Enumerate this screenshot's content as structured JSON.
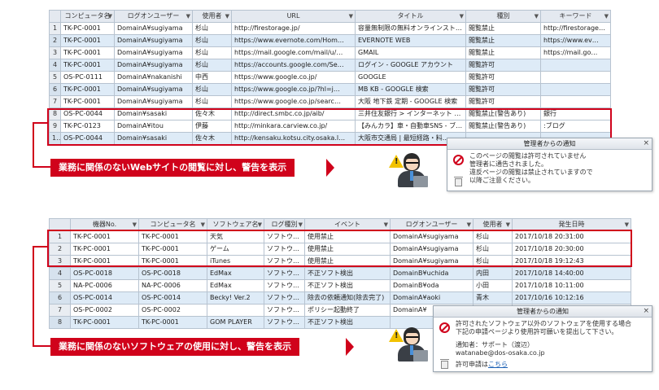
{
  "table1": {
    "headers": [
      "",
      "コンピュータ名",
      "ログオンユーザー",
      "使用者",
      "URL",
      "タイトル",
      "種別",
      "キーワード"
    ],
    "filter_glyph": "▼",
    "rows": [
      [
        "1",
        "TK-PC-0001",
        "DomainA¥sugiyama",
        "杉山",
        "http://firestorage.jp/",
        "容量無制限の無料オンラインストレ…",
        "閲覧禁止",
        "http://firestorage…"
      ],
      [
        "2",
        "TK-PC-0001",
        "DomainA¥sugiyama",
        "杉山",
        "https://www.evernote.com/Hom…",
        "EVERNOTE WEB",
        "閲覧禁止",
        "https://www.ev…"
      ],
      [
        "3",
        "TK-PC-0001",
        "DomainA¥sugiyama",
        "杉山",
        "https://mail.google.com/mail/u/…",
        "GMAIL",
        "閲覧禁止",
        "https://mail.go…"
      ],
      [
        "4",
        "TK-PC-0001",
        "DomainA¥sugiyama",
        "杉山",
        "https://accounts.google.com/Se…",
        "ログイン - GOOGLE アカウント",
        "閲覧許可",
        ""
      ],
      [
        "5",
        "OS-PC-0111",
        "DomainA¥nakanishi",
        "中西",
        "https://www.google.co.jp/",
        "GOOGLE",
        "閲覧許可",
        ""
      ],
      [
        "6",
        "TK-PC-0001",
        "DomainA¥sugiyama",
        "杉山",
        "https://www.google.co.jp/?hl=j…",
        "MB KB - GOOGLE 検索",
        "閲覧許可",
        ""
      ],
      [
        "7",
        "TK-PC-0001",
        "DomainA¥sugiyama",
        "杉山",
        "https://www.google.co.jp/searc…",
        "大阪 地下鉄 定期 - GOOGLE 検索",
        "閲覧許可",
        ""
      ],
      [
        "8",
        "OS-PC-0044",
        "Domain¥sasaki",
        "佐々木",
        "http://direct.smbc.co.jp/aib/",
        "三井住友銀行 > インターネット バ…",
        "閲覧禁止(警告あり)",
        "銀行"
      ],
      [
        "9",
        "TK-PC-0123",
        "DomainA¥itou",
        "伊藤",
        "http://minkara.carview.co.jp/",
        "【みんカラ】車・自動車SNS - ブロ…",
        "閲覧禁止(警告あり)",
        ":ブログ"
      ],
      [
        "10",
        "OS-PC-0044",
        "Domain¥sasaki",
        "佐々木",
        "http://kensaku.kotsu.city.osaka.l…",
        "大阪市交通局 | 最短経路・料…",
        "",
        ""
      ]
    ]
  },
  "banner1": "業務に関係のないWebサイトの閲覧に対し、警告を表示",
  "popup1": {
    "title": "管理者からの通知",
    "close": "×",
    "lines": [
      "このページの閲覧は許可されていません",
      "管理者に通告されました。",
      "違反ページの閲覧は禁止されていますので",
      "以降ご注意ください。"
    ]
  },
  "table2": {
    "headers": [
      "",
      "機器No.",
      "コンピュータ名",
      "ソフトウェア名",
      "ログ種別",
      "イベント",
      "ログオンユーザー",
      "使用者",
      "発生日時"
    ],
    "filter_glyph": "▼",
    "rows": [
      [
        "1",
        "TK-PC-0001",
        "TK-PC-0001",
        "天気",
        "ソフトウェア",
        "使用禁止",
        "DomainA¥sugiyama",
        "杉山",
        "2017/10/18 20:31:00"
      ],
      [
        "2",
        "TK-PC-0001",
        "TK-PC-0001",
        "ゲーム",
        "ソフトウェア",
        "使用禁止",
        "DomainA¥sugiyama",
        "杉山",
        "2017/10/18 20:30:00"
      ],
      [
        "3",
        "TK-PC-0001",
        "TK-PC-0001",
        "iTunes",
        "ソフトウェア",
        "使用禁止",
        "DomainA¥sugiyama",
        "杉山",
        "2017/10/18 19:12:43"
      ],
      [
        "4",
        "OS-PC-0018",
        "OS-PC-0018",
        "EdMax",
        "ソフトウェア",
        "不正ソフト検出",
        "DomainB¥uchida",
        "内田",
        "2017/10/18 14:40:00"
      ],
      [
        "5",
        "NA-PC-0006",
        "NA-PC-0006",
        "EdMax",
        "ソフトウェア",
        "不正ソフト検出",
        "DomainB¥oda",
        "小田",
        "2017/10/18 10:11:00"
      ],
      [
        "6",
        "OS-PC-0014",
        "OS-PC-0014",
        "Becky! Ver.2",
        "ソフトウェア",
        "除去の依頼通知(除去完了)",
        "DomainA¥aoki",
        "青木",
        "2017/10/16 10:12:16"
      ],
      [
        "7",
        "OS-PC-0002",
        "OS-PC-0002",
        "",
        "ソフトウェア",
        "ポリシー起動終了",
        "DomainA¥",
        "",
        ""
      ],
      [
        "8",
        "TK-PC-0001",
        "TK-PC-0001",
        "GOM PLAYER",
        "ソフトウェア",
        "不正ソフト検出",
        "",
        "",
        ""
      ]
    ]
  },
  "banner2": "業務に関係のないソフトウェアの使用に対し、警告を表示",
  "popup2": {
    "title": "管理者からの通知",
    "close": "×",
    "lines": [
      "許可されたソフトウェア以外のソフトウェアを使用する場合",
      "下記の申請ページより使用許可願いを提出して下さい。"
    ],
    "contact_lines": [
      "通知者：サポート（渡辺）",
      "watanabe@dos-osaka.co.jp"
    ],
    "apply_prefix": "許可申請は",
    "apply_link": "こちら"
  },
  "colors": {
    "accent_red": "#d0021b",
    "row_alt": "#deebf7",
    "header_bg": "#e4e9f0",
    "warning_yellow": "#f2c200"
  }
}
